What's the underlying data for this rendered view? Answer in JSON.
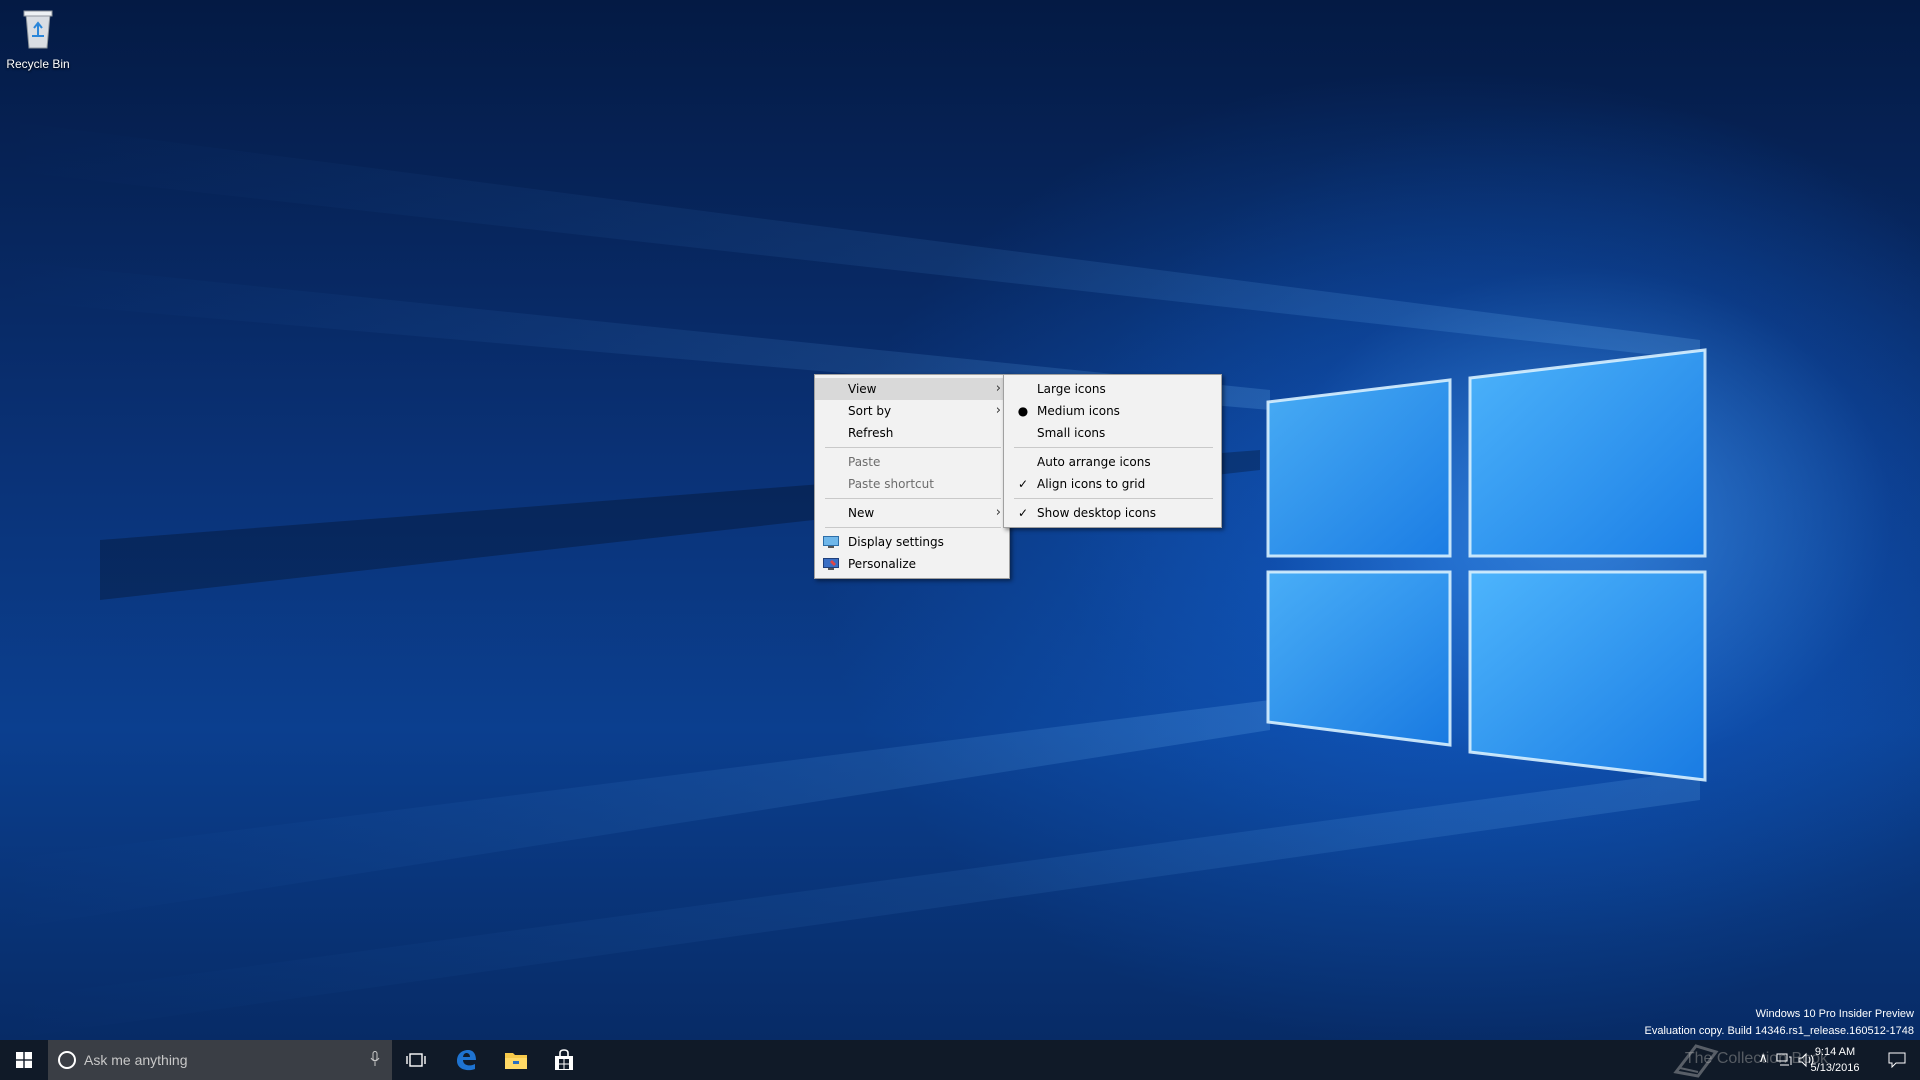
{
  "desktop": {
    "recycle_bin_label": "Recycle Bin"
  },
  "context_menu": {
    "items": [
      {
        "label": "View"
      },
      {
        "label": "Sort by"
      },
      {
        "label": "Refresh"
      },
      {
        "label": "Paste"
      },
      {
        "label": "Paste shortcut"
      },
      {
        "label": "New"
      },
      {
        "label": "Display settings"
      },
      {
        "label": "Personalize"
      }
    ]
  },
  "view_submenu": {
    "items": [
      {
        "label": "Large icons"
      },
      {
        "label": "Medium icons"
      },
      {
        "label": "Small icons"
      },
      {
        "label": "Auto arrange icons"
      },
      {
        "label": "Align icons to grid"
      },
      {
        "label": "Show desktop icons"
      }
    ]
  },
  "taskbar": {
    "search_placeholder": "Ask me anything",
    "clock_time": "9:14 AM",
    "clock_date": "5/13/2016"
  },
  "watermark": {
    "line1": "Windows 10 Pro Insider Preview",
    "line2": "Evaluation copy. Build 14346.rs1_release.160512-1748",
    "overlay": "The Collection Book"
  },
  "colors": {
    "menu_bg": "#f2f2f2",
    "menu_highlight": "#d9d9d9",
    "taskbar_bg": "#101a28",
    "edge_blue": "#1e73d1"
  }
}
